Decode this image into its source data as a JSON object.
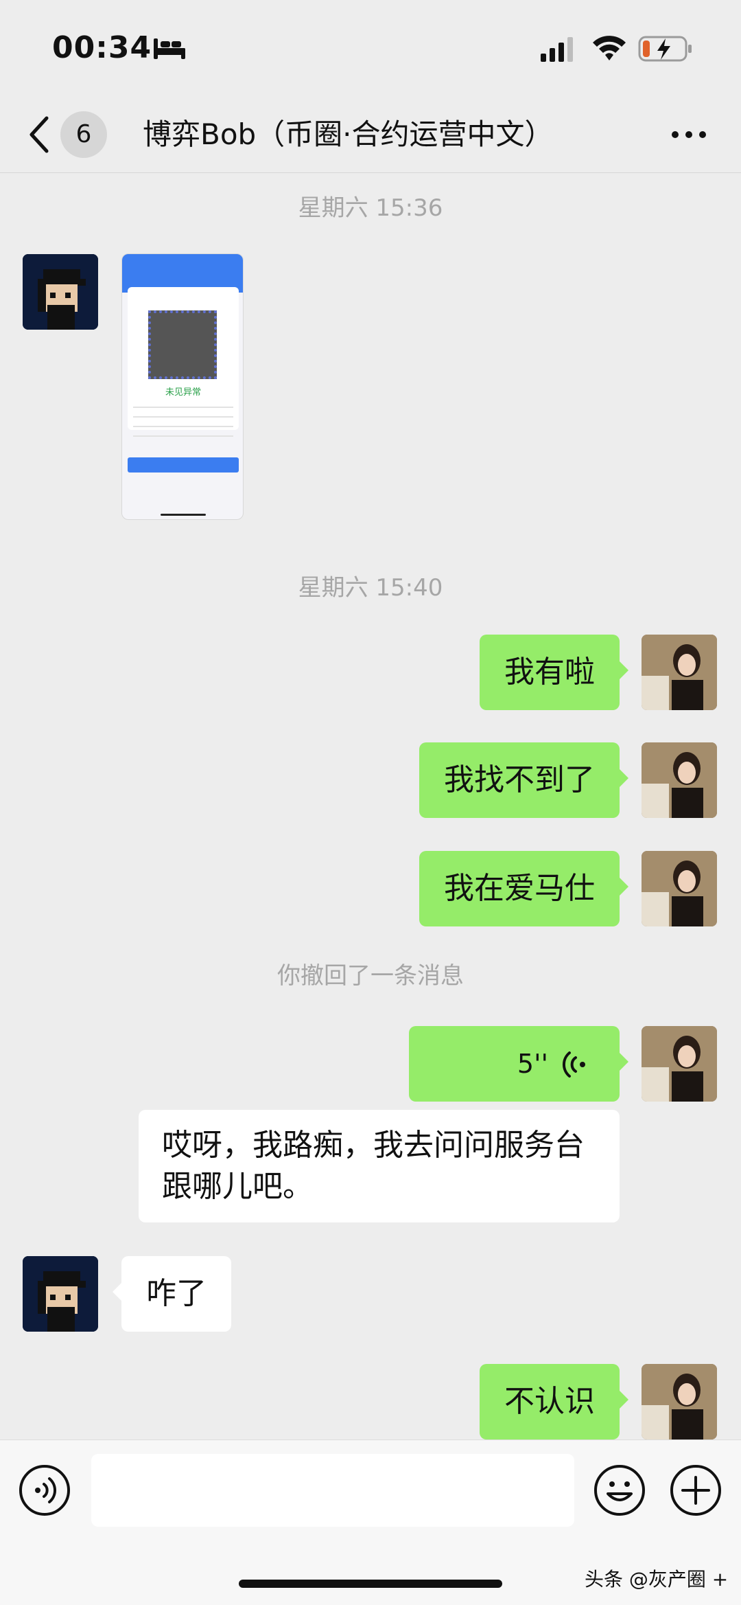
{
  "status_bar": {
    "time": "00:34",
    "icons": [
      "bed-icon",
      "signal-icon",
      "wifi-icon",
      "battery-charging-icon"
    ]
  },
  "nav": {
    "back_icon": "chevron-left-icon",
    "unread_count": "6",
    "title": "博弈Bob（币圈·合约运营中文）",
    "more_icon": "more-dots-icon"
  },
  "messages": {
    "time_1": "星期六 15:36",
    "image_status_text": "未见异常",
    "time_2": "星期六 15:40",
    "sent_1": "我有啦",
    "sent_2": "我找不到了",
    "sent_3": "我在爱马仕",
    "recall_notice": "你撤回了一条消息",
    "voice_duration": "5''",
    "reply_line_1": "哎呀，我路痴，我去问问服务台",
    "reply_line_2": "跟哪儿吧。",
    "received_2": "咋了",
    "sent_4": "不认识"
  },
  "input_bar": {
    "voice_icon": "voice-mode-icon",
    "text_value": "",
    "emoji_icon": "emoji-icon",
    "plus_icon": "plus-circle-icon"
  },
  "watermark": "头条 @灰产圈 +",
  "colors": {
    "background": "#ededed",
    "sent_bubble": "#95ec69",
    "received_bubble": "#ffffff",
    "timestamp_text": "#a6a6a6"
  }
}
